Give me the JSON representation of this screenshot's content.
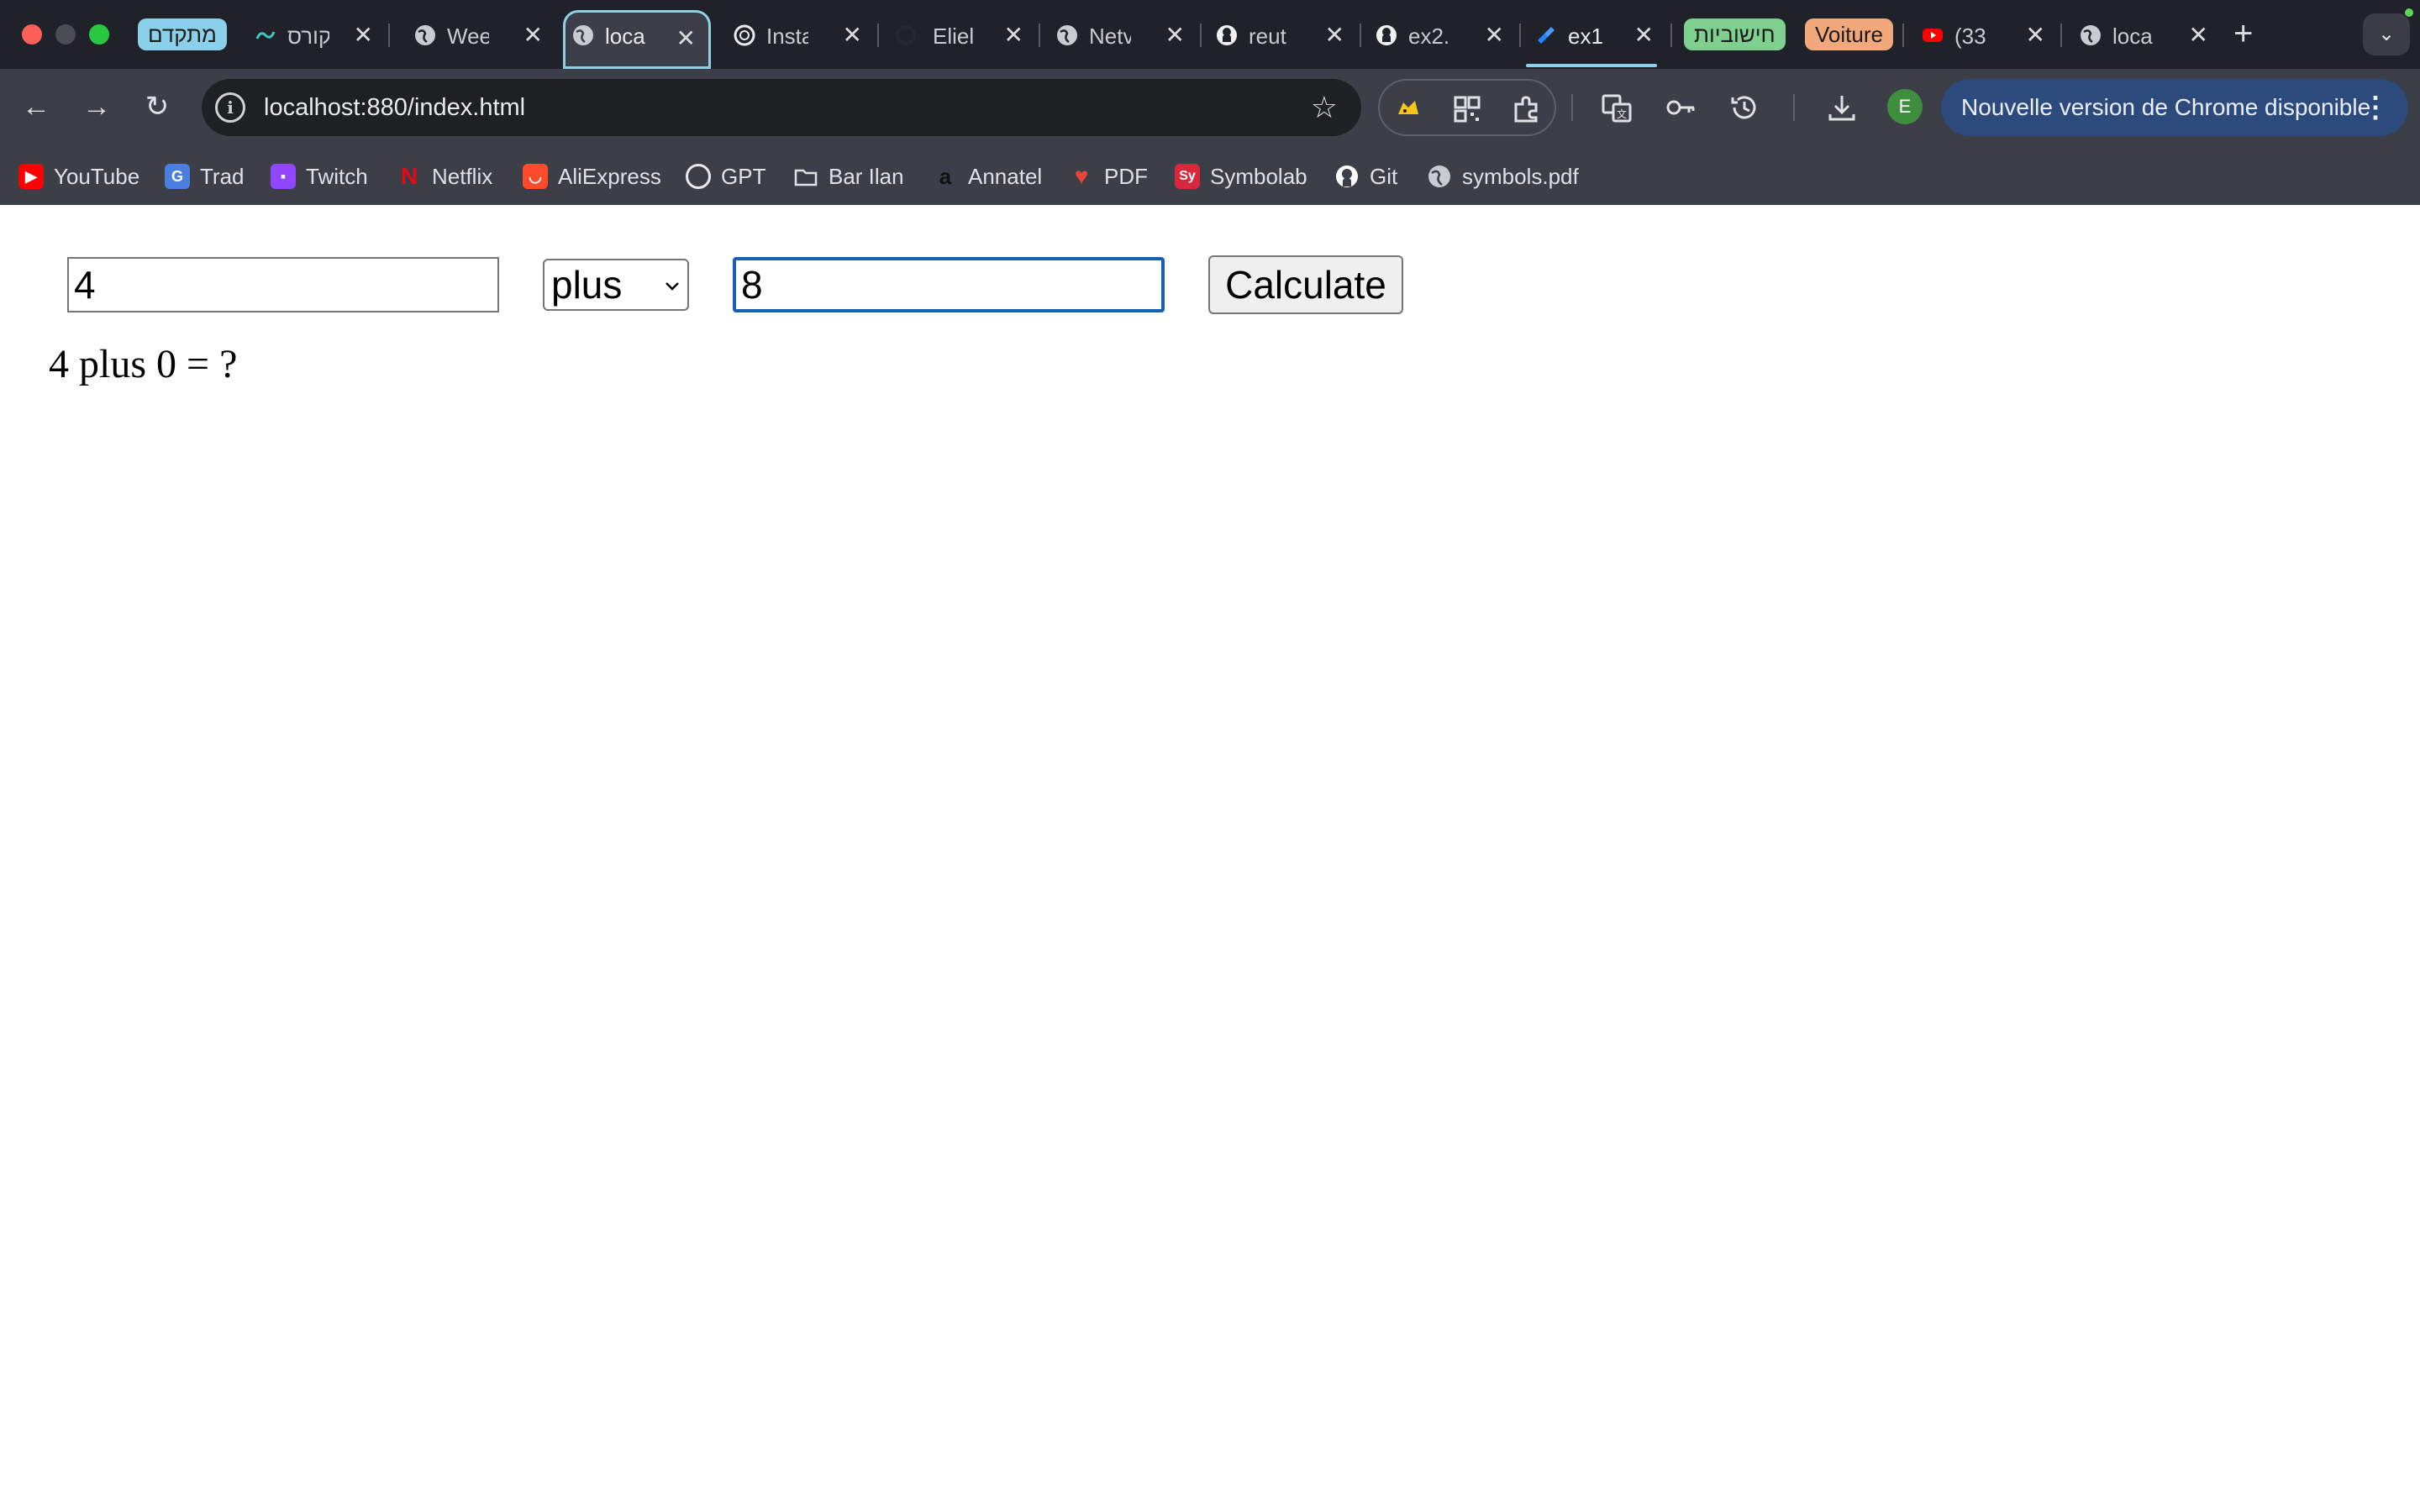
{
  "browser": {
    "tab_groups": [
      {
        "label": "מתקדם",
        "color": "#8bd0ea"
      },
      {
        "label": "חישוביות",
        "color": "#7fcf8f"
      },
      {
        "label": "Voiture",
        "color": "#f2a87a"
      }
    ],
    "tabs": [
      {
        "title": "קורס",
        "icon": "graduation-icon"
      },
      {
        "title": "Wee",
        "icon": "globe-icon"
      },
      {
        "title": "loca",
        "icon": "globe-icon",
        "active": true
      },
      {
        "title": "Insta",
        "icon": "openai-icon"
      },
      {
        "title": "Eliel",
        "icon": "github-icon"
      },
      {
        "title": "Netv",
        "icon": "globe-icon"
      },
      {
        "title": "reut",
        "icon": "github-icon"
      },
      {
        "title": "ex2.",
        "icon": "github-icon"
      },
      {
        "title": "ex1",
        "icon": "jira-icon"
      },
      {
        "title": "(33",
        "icon": "youtube-icon"
      },
      {
        "title": "loca",
        "icon": "globe-icon"
      }
    ],
    "new_tab_label": "+",
    "url": "localhost:880/index.html",
    "avatar_letter": "E",
    "update_notice": "Nouvelle version de Chrome disponible",
    "bookmarks": [
      {
        "label": "YouTube",
        "icon": "youtube-icon",
        "color": "#ff0000"
      },
      {
        "label": "Trad",
        "icon": "translate-icon",
        "color": "#4a7fe0"
      },
      {
        "label": "Twitch",
        "icon": "twitch-icon",
        "color": "#9146ff"
      },
      {
        "label": "Netflix",
        "icon": "netflix-icon",
        "color": "#e50914"
      },
      {
        "label": "AliExpress",
        "icon": "aliexpress-icon",
        "color": "#ff4b2b"
      },
      {
        "label": "GPT",
        "icon": "openai-icon",
        "color": "#e8eaed"
      },
      {
        "label": "Bar Ilan",
        "icon": "folder-icon",
        "color": "#dfe1e5"
      },
      {
        "label": "Annatel",
        "icon": "annatel-icon",
        "color": "#1b1b1b"
      },
      {
        "label": "PDF",
        "icon": "pdf-heart-icon",
        "color": "#e8443a"
      },
      {
        "label": "Symbolab",
        "icon": "symbolab-icon",
        "color": "#d9283d"
      },
      {
        "label": "Git",
        "icon": "github-icon",
        "color": "#ffffff"
      },
      {
        "label": "symbols.pdf",
        "icon": "globe-icon",
        "color": "#dfe1e5"
      }
    ]
  },
  "calculator": {
    "num1_value": "4",
    "operator_value": "plus",
    "num2_value": "8",
    "calculate_label": "Calculate",
    "result_text": "4 plus 0 = ?"
  }
}
